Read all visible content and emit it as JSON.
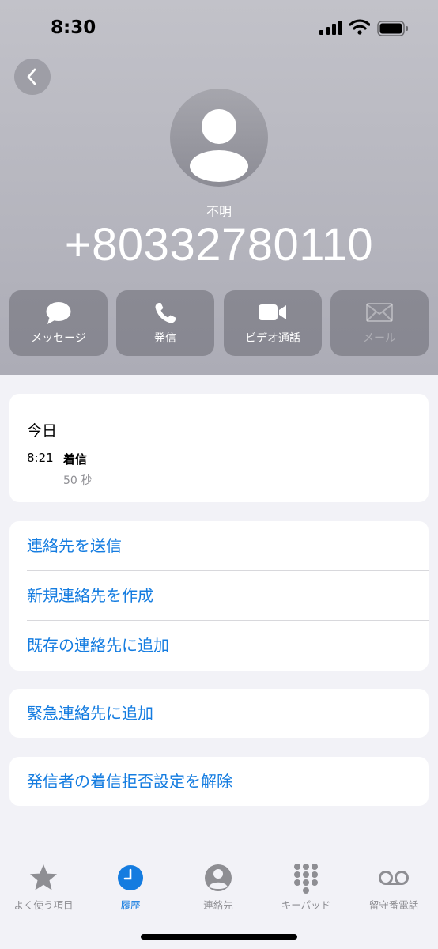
{
  "status_bar": {
    "time": "8:30"
  },
  "caller": {
    "label": "不明",
    "number": "+80332780110"
  },
  "actions": [
    {
      "label": "メッセージ",
      "icon": "message-bubble-icon",
      "enabled": true
    },
    {
      "label": "発信",
      "icon": "phone-icon",
      "enabled": true
    },
    {
      "label": "ビデオ通話",
      "icon": "video-camera-icon",
      "enabled": true
    },
    {
      "label": "メール",
      "icon": "envelope-icon",
      "enabled": false
    }
  ],
  "call_log": {
    "day": "今日",
    "entries": [
      {
        "time": "8:21",
        "type": "着信",
        "duration": "50 秒"
      }
    ]
  },
  "contact_options": [
    "連絡先を送信",
    "新規連絡先を作成",
    "既存の連絡先に追加"
  ],
  "emergency_option": "緊急連絡先に追加",
  "block_option": "発信者の着信拒否設定を解除",
  "tabs": [
    {
      "label": "よく使う項目",
      "icon": "star-icon",
      "active": false
    },
    {
      "label": "履歴",
      "icon": "clock-icon",
      "active": true
    },
    {
      "label": "連絡先",
      "icon": "person-circle-icon",
      "active": false
    },
    {
      "label": "キーパッド",
      "icon": "keypad-icon",
      "active": false
    },
    {
      "label": "留守番電話",
      "icon": "voicemail-icon",
      "active": false
    }
  ],
  "colors": {
    "accent": "#147ce0",
    "header_top": "#c2c2c9",
    "header_bottom": "#acacb6",
    "background": "#f2f2f7",
    "inactive": "#8e8e93"
  }
}
